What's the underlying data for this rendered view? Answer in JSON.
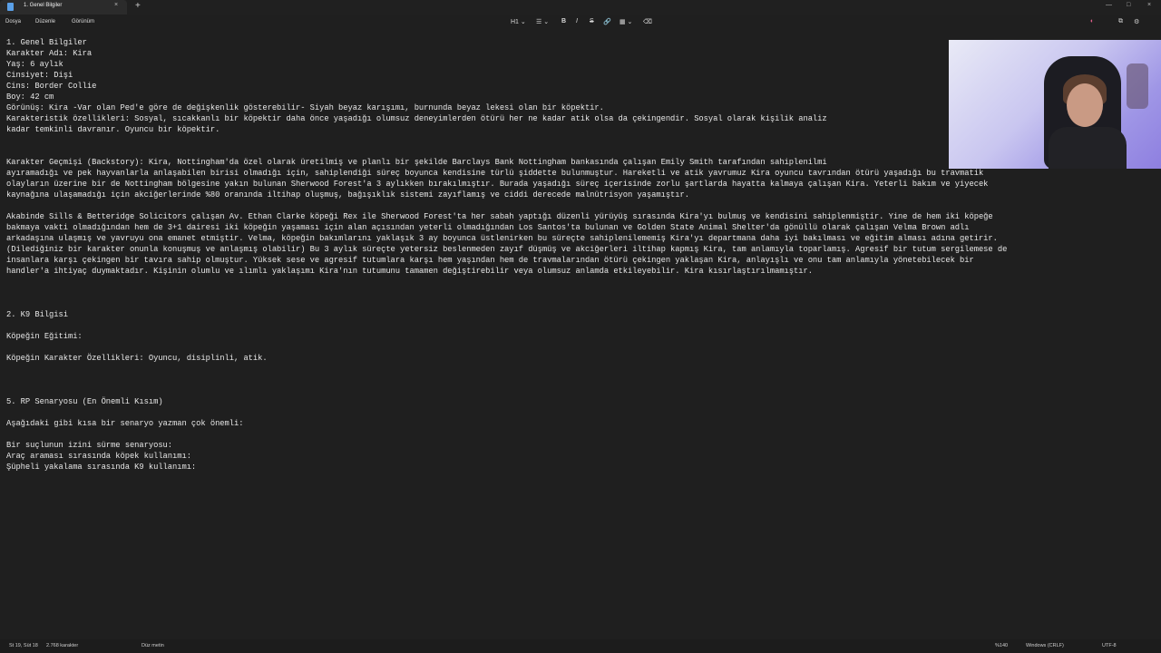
{
  "window": {
    "tab_title": "1. Genel Bilgiler",
    "new_tab": "+",
    "tab_close": "×",
    "controls": [
      "—",
      "□",
      "×"
    ]
  },
  "menu": [
    "Dosya",
    "Düzenle",
    "Görünüm"
  ],
  "toolbar": {
    "heading": "H1 ⌄",
    "list": "☰ ⌄",
    "bold": "B",
    "italic": "I",
    "strikethrough": "S",
    "link": "🔗",
    "table": "▦ ⌄",
    "clear_format": "⌫"
  },
  "right_icons": [
    "◐",
    "⧉",
    "⚙"
  ],
  "document": {
    "lines": [
      "1. Genel Bilgiler",
      "Karakter Adı: Kira",
      "Yaş: 6 aylık",
      "Cinsiyet: Dişi",
      "Cins: Border Collie",
      "Boy: 42 cm",
      "Görünüş: Kira -Var olan Ped'e göre de değişkenlik gösterebilir- Siyah beyaz karışımı, burnunda beyaz lekesi olan bir köpektir.",
      "Karakteristik özellikleri: Sosyal, sıcakkanlı bir köpektir daha önce yaşadığı olumsuz deneyimlerden ötürü her ne kadar atik olsa da çekingendir. Sosyal olarak kişilik analiz",
      "kadar temkinli davranır. Oyuncu bir köpektir.",
      "",
      "",
      "Karakter Geçmişi (Backstory): Kira, Nottingham'da özel olarak üretilmiş ve planlı bir şekilde Barclays Bank Nottingham bankasında çalışan Emily Smith tarafından sahiplenilmi",
      "ayıramadığı ve pek hayvanlarla anlaşabilen birisi olmadığı için, sahiplendiği süreç boyunca kendisine türlü şiddette bulunmuştur. Hareketli ve atik yavrumuz Kira oyuncu tavrından ötürü yaşadığı bu travmatik",
      "olayların üzerine bir de Nottingham bölgesine yakın bulunan Sherwood Forest'a 3 aylıkken bırakılmıştır. Burada yaşadığı süreç içerisinde zorlu şartlarda hayatta kalmaya çalışan Kira. Yeterli bakım ve yiyecek",
      "kaynağına ulaşamadığı için akciğerlerinde %80 oranında iltihap oluşmuş, bağışıklık sistemi zayıflamış ve ciddi derecede malnütrisyon yaşamıştır.",
      "",
      "Akabinde Sills & Betteridge Solicitors çalışan Av. Ethan Clarke köpeği Rex ile Sherwood Forest'ta her sabah yaptığı düzenli yürüyüş sırasında Kira'yı bulmuş ve kendisini sahiplenmiştir. Yine de hem iki köpeğe",
      "bakmaya vakti olmadığından hem de 3+1 dairesi iki köpeğin yaşaması için alan açısından yeterli olmadığından Los Santos'ta bulunan ve Golden State Animal Shelter'da gönüllü olarak çalışan Velma Brown adlı",
      "arkadaşına ulaşmış ve yavruyu ona emanet etmiştir. Velma, köpeğin bakımlarını yaklaşık 3 ay boyunca üstlenirken bu süreçte sahiplenilememiş Kira'yı departmana daha iyi bakılması ve eğitim alması adına getirir.",
      "(Dilediğiniz bir karakter onunla konuşmuş ve anlaşmış olabilir) Bu 3 aylık süreçte yetersiz beslenmeden zayıf düşmüş ve akciğerleri iltihap kapmış Kira, tam anlamıyla toparlamış. Agresif bir tutum sergilemese de",
      "insanlara karşı çekingen bir tavıra sahip olmuştur. Yüksek sese ve agresif tutumlara karşı hem yaşından hem de travmalarından ötürü çekingen yaklaşan Kira, anlayışlı ve onu tam anlamıyla yönetebilecek bir",
      "handler'a ihtiyaç duymaktadır. Kişinin olumlu ve ılımlı yaklaşımı Kira'nın tutumunu tamamen değiştirebilir veya olumsuz anlamda etkileyebilir. Kira kısırlaştırılmamıştır.",
      "",
      "",
      "",
      "2. K9 Bilgisi",
      "",
      "Köpeğin Eğitimi:",
      "",
      "Köpeğin Karakter Özellikleri: Oyuncu, disiplinli, atik.",
      "",
      "",
      "",
      "5. RP Senaryosu (En Önemli Kısım)",
      "",
      "Aşağıdaki gibi kısa bir senaryo yazman çok önemli:",
      "",
      "Bir suçlunun izini sürme senaryosu:",
      "Araç araması sırasında köpek kullanımı:",
      "Şüpheli yakalama sırasında K9 kullanımı:"
    ]
  },
  "status": {
    "position": "St 19, Süt 18",
    "char_count": "2.768 karakter",
    "mode": "Düz metin",
    "zoom": "%140",
    "line_ending": "Windows (CRLF)",
    "encoding": "UTF-8"
  }
}
